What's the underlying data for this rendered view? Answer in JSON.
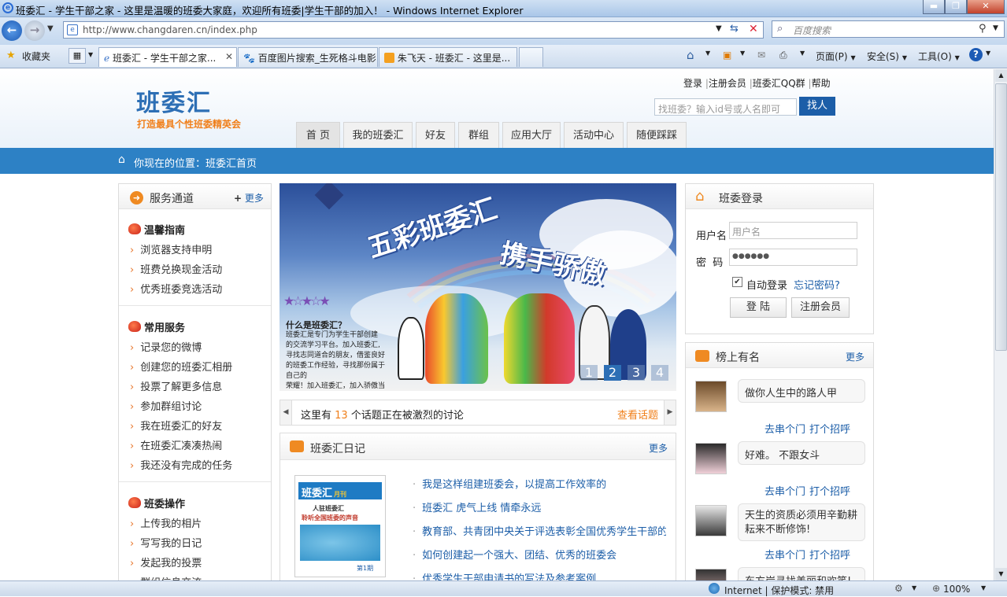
{
  "window": {
    "title": "班委汇 - 学生干部之家 - 这里是温暖的班委大家庭，欢迎所有班委|学生干部的加入！ - Windows Internet Explorer"
  },
  "browser": {
    "url": "http://www.changdaren.cn/index.php",
    "search_placeholder": "百度搜索",
    "favorites_label": "收藏夹",
    "tabs": [
      {
        "label": "班委汇 - 学生干部之家..."
      },
      {
        "label": "百度图片搜索_生死格斗电影"
      },
      {
        "label": "朱飞天 - 班委汇 - 这里是..."
      }
    ],
    "toolbar": {
      "page": "页面(P)",
      "safety": "安全(S)",
      "tools": "工具(O)"
    },
    "status": {
      "zone": "Internet | 保护模式: 禁用",
      "zoom": "100%"
    }
  },
  "header": {
    "logo": "班委汇",
    "slogan": "打造最具个性班委精英会",
    "links": {
      "login": "登录",
      "register": "注册会员",
      "qq": "班委汇QQ群",
      "help": "帮助",
      "sep": "|"
    },
    "find_placeholder": "找班委？输入id号或人名即可",
    "find_button": "找人",
    "nav": [
      "首 页",
      "我的班委汇",
      "好友",
      "群组",
      "应用大厅",
      "活动中心",
      "随便踩踩"
    ]
  },
  "breadcrumb": "你现在的位置：班委汇首页",
  "left": {
    "title": "服务通道",
    "more": "更多",
    "sections": [
      {
        "title": "温馨指南",
        "items": [
          "浏览器支持申明",
          "班费兑换现金活动",
          "优秀班委竞选活动"
        ]
      },
      {
        "title": "常用服务",
        "items": [
          "记录您的微博",
          "创建您的班委汇相册",
          "投票了解更多信息",
          "参加群组讨论",
          "我在班委汇的好友",
          "在班委汇凑凑热闹",
          "我还没有完成的任务"
        ]
      },
      {
        "title": "班委操作",
        "items": [
          "上传我的相片",
          "写写我的日记",
          "发起我的投票",
          "群组信息交流"
        ]
      }
    ]
  },
  "banner": {
    "title1": "五彩班委汇",
    "title2": "携手骄傲",
    "caption_title": "什么是班委汇？",
    "caption_lines": [
      "班委汇是专门为学生干部创建",
      "的交流学习平台。加入班委汇,",
      "寻找志同道合的朋友，借鉴良好",
      "的班委工作经验，寻找那份属于自己的",
      "荣耀！加入班委汇，加入骄傲当中！"
    ],
    "slides": [
      "1",
      "2",
      "3",
      "4"
    ]
  },
  "ticker": {
    "prefix": "这里有",
    "count": "13",
    "suffix": "个话题正在被激烈的讨论",
    "link": "查看话题"
  },
  "diary": {
    "title": "班委汇日记",
    "more": "更多",
    "magazine": {
      "name": "班委汇",
      "sub": "月刊",
      "headline1": "人驻班委汇",
      "headline2": "聆听全国班委的声音",
      "issue": "第1期"
    },
    "items": [
      "我是这样组建班委会，以提高工作效率的",
      "班委汇  虎气上线  情牵永远",
      "教育部、共青团中央关于评选表彰全国优秀学生干部的通",
      "如何创建起一个强大、团结、优秀的班委会",
      "优秀学生干部申请书的写法及参考案例"
    ]
  },
  "login": {
    "title": "班委登录",
    "user_label": "用户名",
    "user_placeholder": "用户名",
    "pwd_label": "密  码",
    "pwd_value": "●●●●●●",
    "auto_login": "自动登录",
    "forgot": "忘记密码?",
    "login_button": "登  陆",
    "register_button": "注册会员"
  },
  "ranking": {
    "title": "榜上有名",
    "more": "更多",
    "visit": "去串个门",
    "greet": "打个招呼",
    "items": [
      {
        "text": "做你人生中的路人甲"
      },
      {
        "text": "好难。 不跟女斗"
      },
      {
        "text": "天生的资质必须用辛勤耕耘来不断修饰!"
      },
      {
        "text": "东方岸寻找美丽和欢笑!"
      }
    ]
  },
  "colors": {
    "brand": "#2d6fb5",
    "accent": "#f07f1a",
    "crumb": "#2d81c5"
  }
}
